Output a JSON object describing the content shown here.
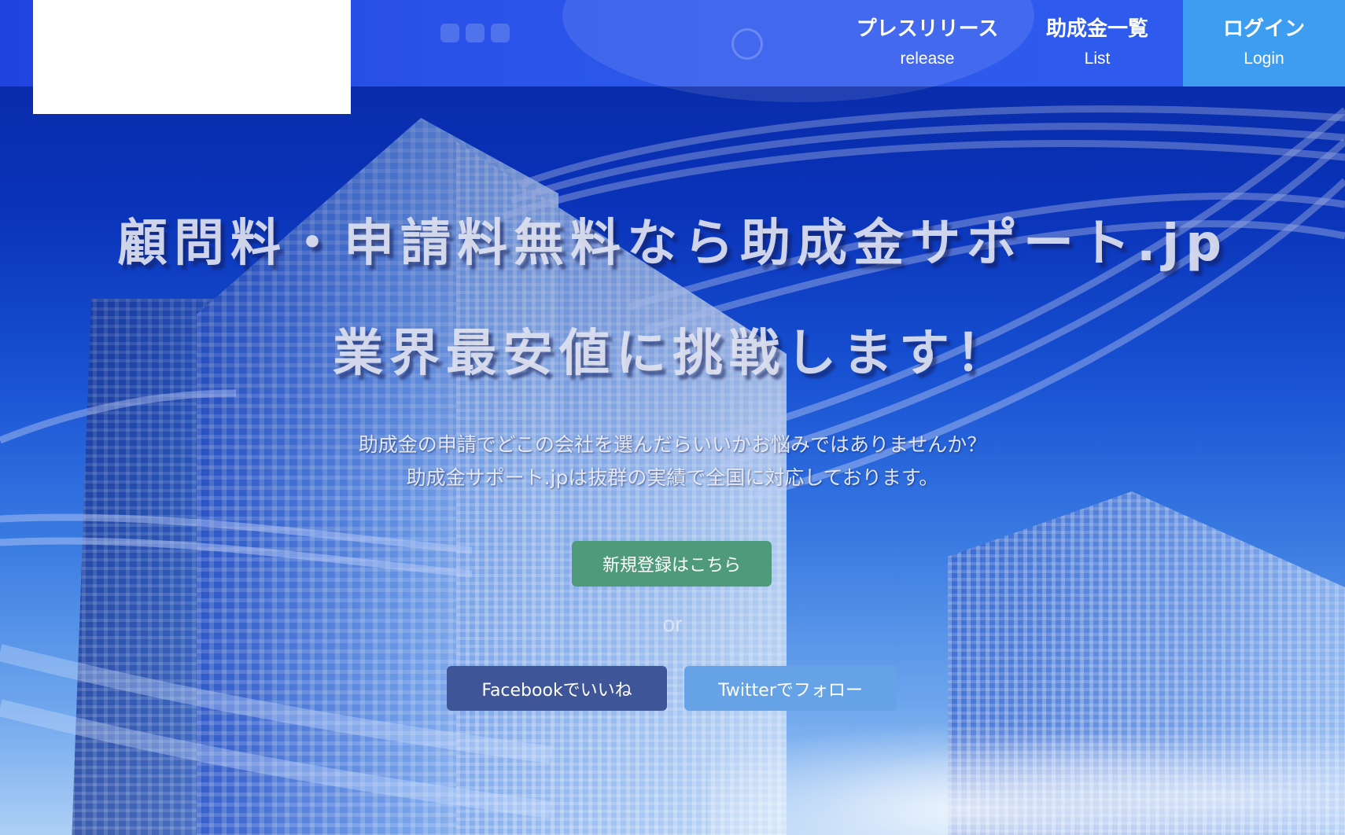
{
  "site": {
    "logo_alt": ""
  },
  "nav": {
    "release": {
      "label_jp": "プレスリリース",
      "label_en": "release"
    },
    "list": {
      "label_jp": "助成金一覧",
      "label_en": "List"
    },
    "login": {
      "label_jp": "ログイン",
      "label_en": "Login"
    }
  },
  "hero": {
    "headline_1": "顧問料・申請料無料なら助成金サポート.jp",
    "headline_2": "業界最安値に挑戦します！",
    "subtext_1": "助成金の申請でどこの会社を選んだらいいかお悩みではありませんか？",
    "subtext_2": "助成金サポート.jpは抜群の実績で全国に対応しております。",
    "register_button": "新規登録はこちら",
    "or_text": "or",
    "facebook_button": "Facebookでいいね",
    "twitter_button": "Twitterでフォロー"
  },
  "colors": {
    "header_bg": "#2b55ea",
    "login_bg": "#3d9df0",
    "register_bg": "#4f9a7a",
    "facebook_bg": "#3e5698",
    "twitter_bg": "#65a2e6"
  }
}
